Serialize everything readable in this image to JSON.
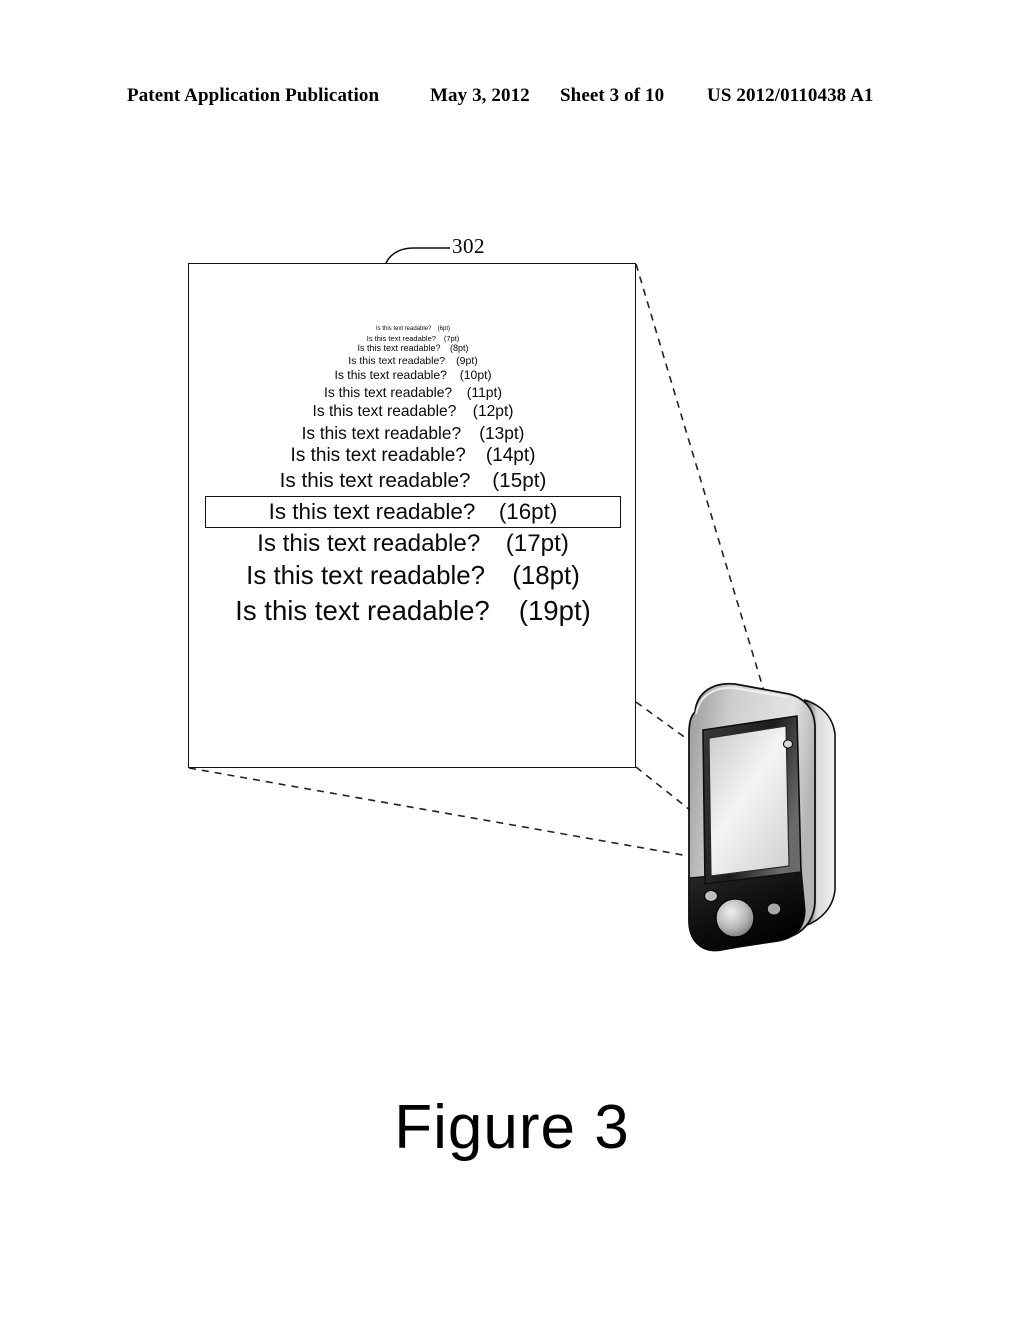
{
  "header": {
    "publication": "Patent Application Publication",
    "date": "May 3, 2012",
    "sheet": "Sheet 3 of 10",
    "patent_number": "US 2012/0110438 A1"
  },
  "figure": {
    "caption": "Figure 3",
    "reference_numeral": "302"
  },
  "document": {
    "label": "302",
    "sample_lines": [
      {
        "phrase": "Is this text readable?",
        "size_label": "(6pt)",
        "font_px": 6.0,
        "selected": false
      },
      {
        "phrase": "Is this text readable?",
        "size_label": "(7pt)",
        "font_px": 7.5,
        "selected": false
      },
      {
        "phrase": "Is this text readable?",
        "size_label": "(8pt)",
        "font_px": 9.0,
        "selected": false
      },
      {
        "phrase": "Is this text readable?",
        "size_label": "(9pt)",
        "font_px": 10.5,
        "selected": false
      },
      {
        "phrase": "Is this text readable?",
        "size_label": "(10pt)",
        "font_px": 12.2,
        "selected": false
      },
      {
        "phrase": "Is this text readable?",
        "size_label": "(11pt)",
        "font_px": 13.9,
        "selected": false
      },
      {
        "phrase": "Is this text readable?",
        "size_label": "(12pt)",
        "font_px": 15.6,
        "selected": false
      },
      {
        "phrase": "Is this text readable?",
        "size_label": "(13pt)",
        "font_px": 17.3,
        "selected": false
      },
      {
        "phrase": "Is this text readable?",
        "size_label": "(14pt)",
        "font_px": 19.0,
        "selected": false
      },
      {
        "phrase": "Is this text readable?",
        "size_label": "(15pt)",
        "font_px": 20.7,
        "selected": false
      },
      {
        "phrase": "Is this text readable?",
        "size_label": "(16pt)",
        "font_px": 22.4,
        "selected": true
      },
      {
        "phrase": "Is this text readable?",
        "size_label": "(17pt)",
        "font_px": 24.2,
        "selected": false
      },
      {
        "phrase": "Is this text readable?",
        "size_label": "(18pt)",
        "font_px": 25.9,
        "selected": false
      },
      {
        "phrase": "Is this text readable?",
        "size_label": "(19pt)",
        "font_px": 27.6,
        "selected": false
      }
    ]
  },
  "device": {
    "name": "handheld-pda",
    "screen_label": "",
    "buttons": [
      "nav-pad",
      "side-button-left",
      "side-button-right"
    ]
  },
  "colors": {
    "ink": "#000000",
    "paper": "#ffffff",
    "device_body_light": "#d9d9d9",
    "device_body_mid": "#8f8f8f",
    "device_body_dark": "#1b1b1b",
    "screen_light": "#e8e8e8"
  }
}
